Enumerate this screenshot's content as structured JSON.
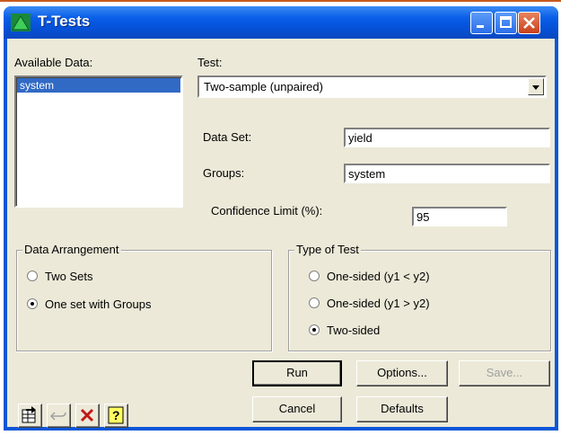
{
  "window": {
    "title": "T-Tests",
    "icons": [
      "app-icon",
      "minimize-icon",
      "maximize-icon",
      "close-icon"
    ]
  },
  "available_data": {
    "label": "Available Data:",
    "items": [
      "system"
    ],
    "selected": "system"
  },
  "test": {
    "label": "Test:",
    "value": "Two-sample (unpaired)"
  },
  "fields": {
    "data_set_label": "Data Set:",
    "data_set_value": "yield",
    "groups_label": "Groups:",
    "groups_value": "system",
    "confidence_label": "Confidence Limit (%):",
    "confidence_value": "95"
  },
  "data_arrangement": {
    "title": "Data Arrangement",
    "options": [
      "Two Sets",
      "One set with Groups"
    ],
    "selected": "One set with Groups"
  },
  "type_of_test": {
    "title": "Type of Test",
    "options": [
      "One-sided (y1 < y2)",
      "One-sided (y1 > y2)",
      "Two-sided"
    ],
    "selected": "Two-sided"
  },
  "buttons": {
    "run": "Run",
    "options": "Options...",
    "save": "Save...",
    "cancel": "Cancel",
    "defaults": "Defaults"
  },
  "small_buttons": [
    "copy-to-spreadsheet-icon",
    "undo-icon",
    "clear-icon",
    "help-icon"
  ],
  "colors": {
    "titlebar": "#0a5ee8",
    "dialog_bg": "#ece9d8",
    "selection": "#316ac5"
  }
}
